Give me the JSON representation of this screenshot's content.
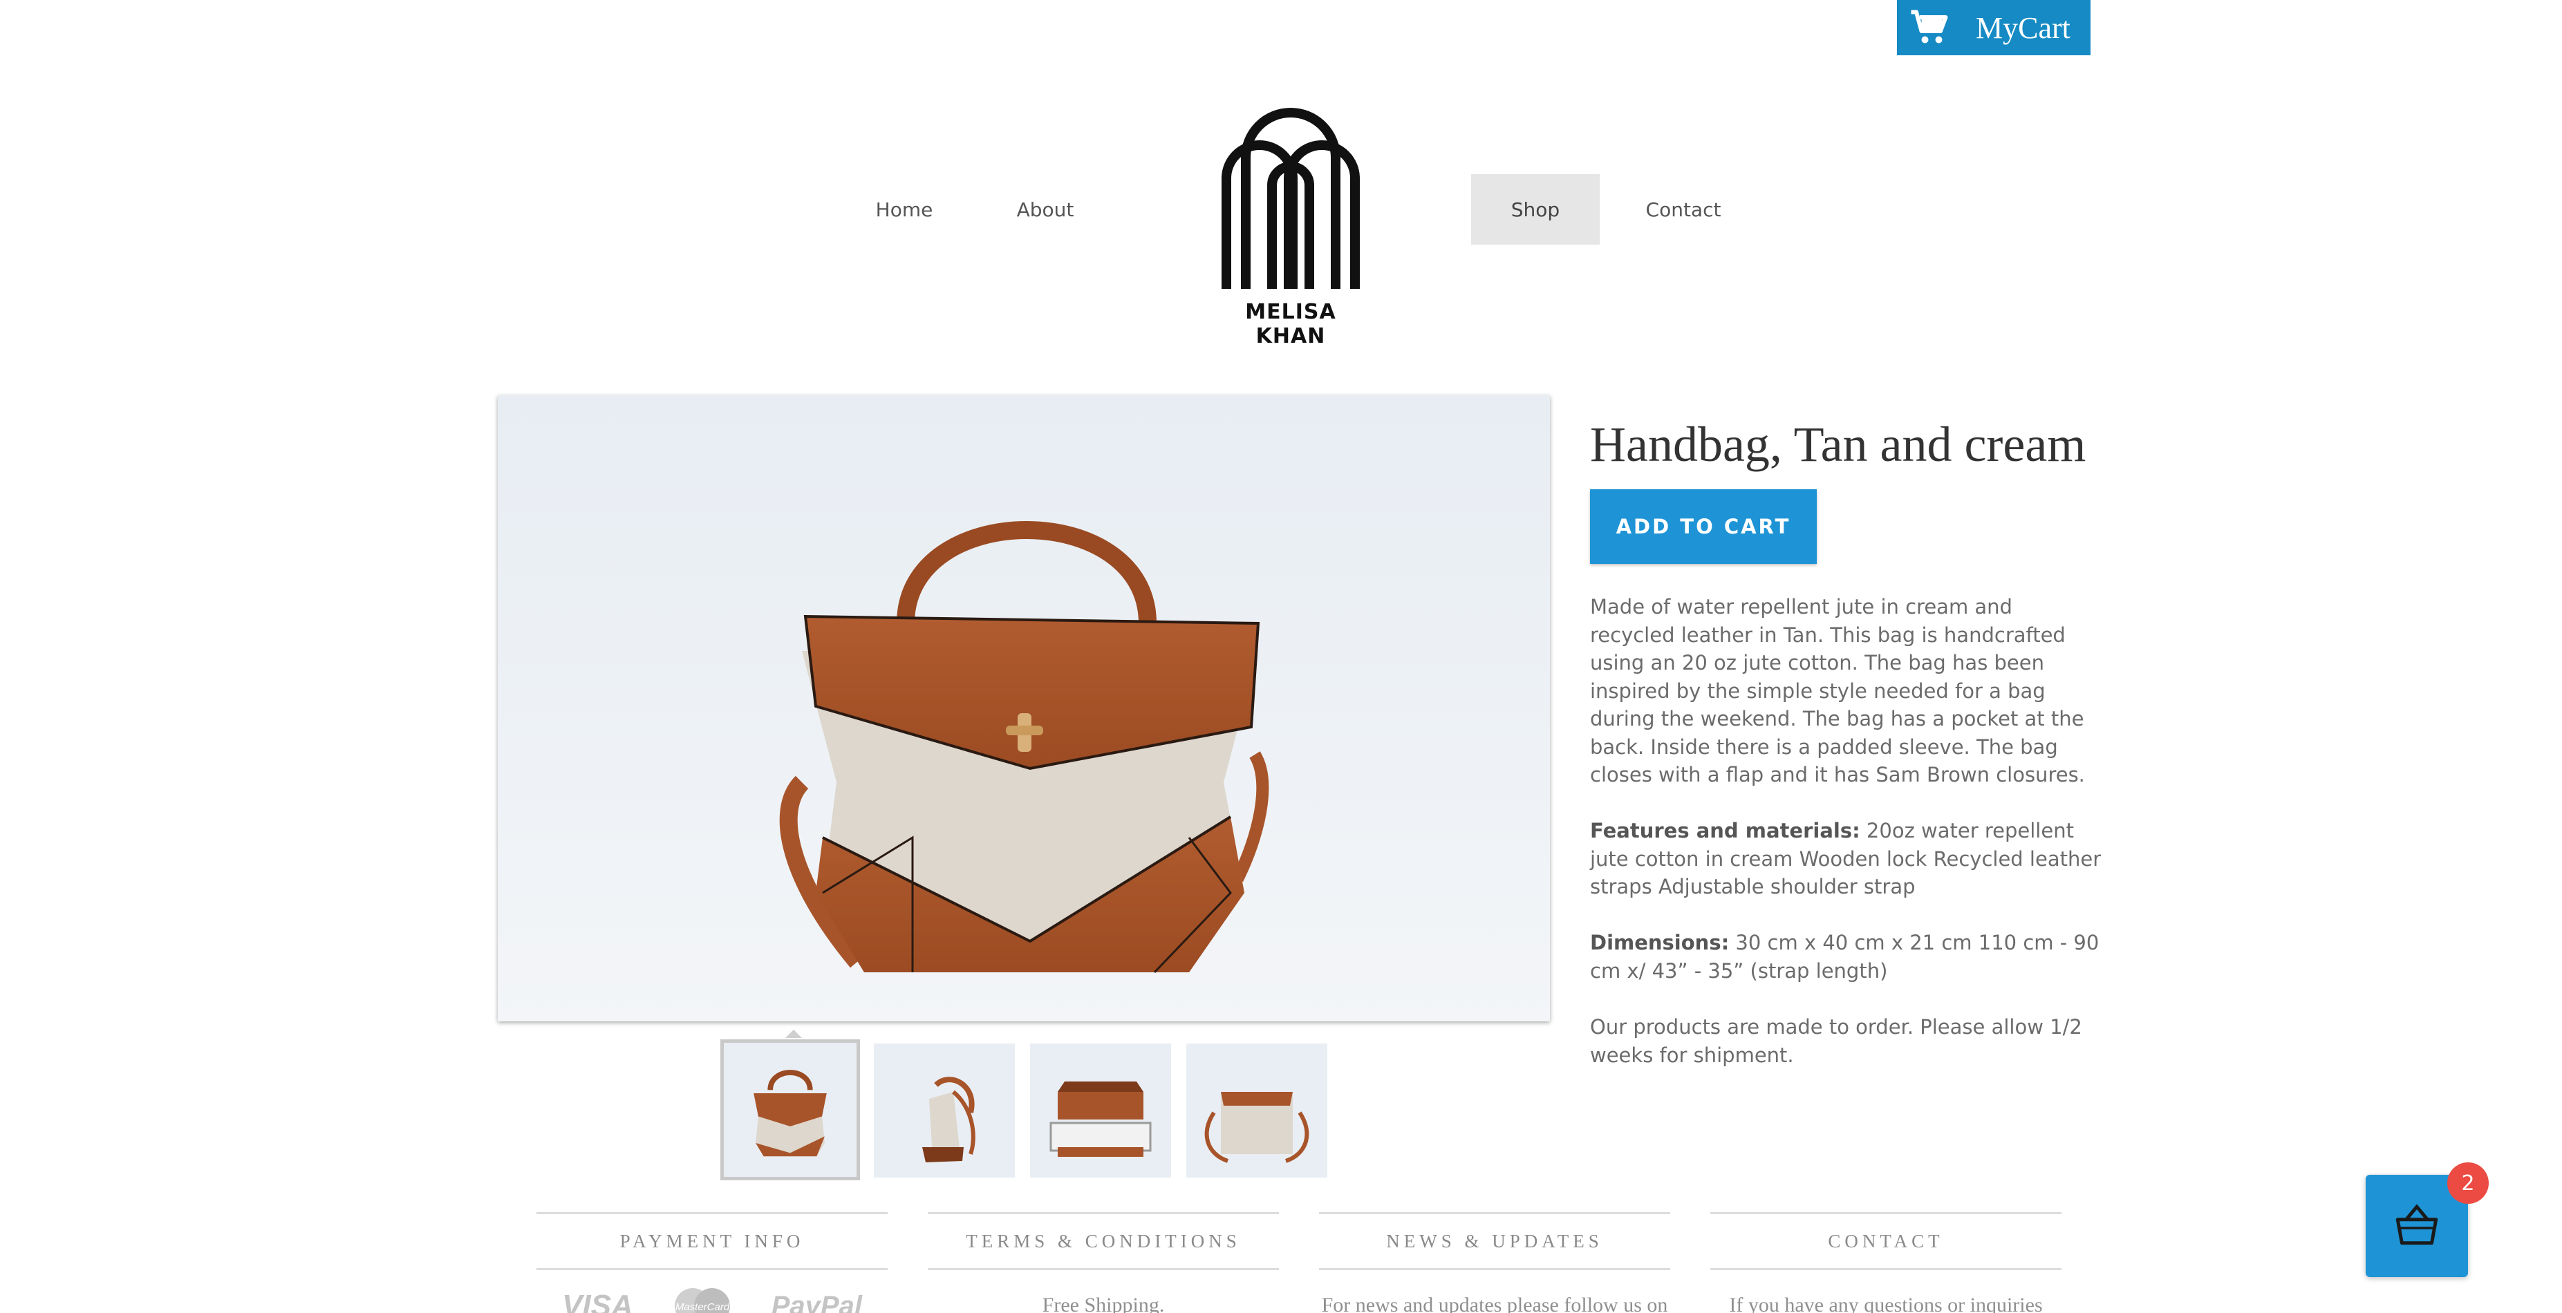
{
  "cart": {
    "label": "MyCart",
    "icon": "shopping-cart-icon"
  },
  "nav": {
    "items": [
      {
        "label": "Home"
      },
      {
        "label": "About"
      },
      {
        "label": "Shop",
        "active": true
      },
      {
        "label": "Contact"
      }
    ]
  },
  "logo": {
    "text": "MELISA KHAN"
  },
  "product": {
    "title": "Handbag, Tan and cream",
    "add_to_cart": "ADD TO CART",
    "description": "Made of water repellent jute in cream and recycled leather in Tan. This bag is handcrafted using an 20 oz jute cotton. The bag has been inspired by the simple style needed for a bag during the weekend. The bag has a pocket at the back. Inside there is a padded sleeve. The bag closes with a flap and it has Sam Brown closures.",
    "features_label": "Features and materials:",
    "features_text": " 20oz water repellent jute cotton in cream Wooden lock Recycled leather straps Adjustable shoulder strap",
    "dimensions_label": "Dimensions:",
    "dimensions_text": " 30 cm x 40 cm x 21 cm 110 cm - 90 cm x/ 43” - 35” (strap length)",
    "order_note": "Our products are made to order. Please allow 1/2 weeks for shipment."
  },
  "footer": {
    "columns": [
      {
        "heading": "PAYMENT INFO",
        "payment": [
          "VISA",
          "MasterCard",
          "PayPal"
        ]
      },
      {
        "heading": "TERMS & CONDITIONS",
        "text": "Free Shipping."
      },
      {
        "heading": "NEWS & UPDATES",
        "text": "For news and updates please follow us on"
      },
      {
        "heading": "CONTACT",
        "text": "If you have any questions or inquiries"
      }
    ]
  },
  "basket": {
    "count": "2",
    "icon": "basket-icon"
  },
  "colors": {
    "accent": "#1e94d6",
    "cart_bg": "#168ac4",
    "badge": "#ec4b43",
    "leather": "#a8542a",
    "jute": "#ddd7cd"
  }
}
